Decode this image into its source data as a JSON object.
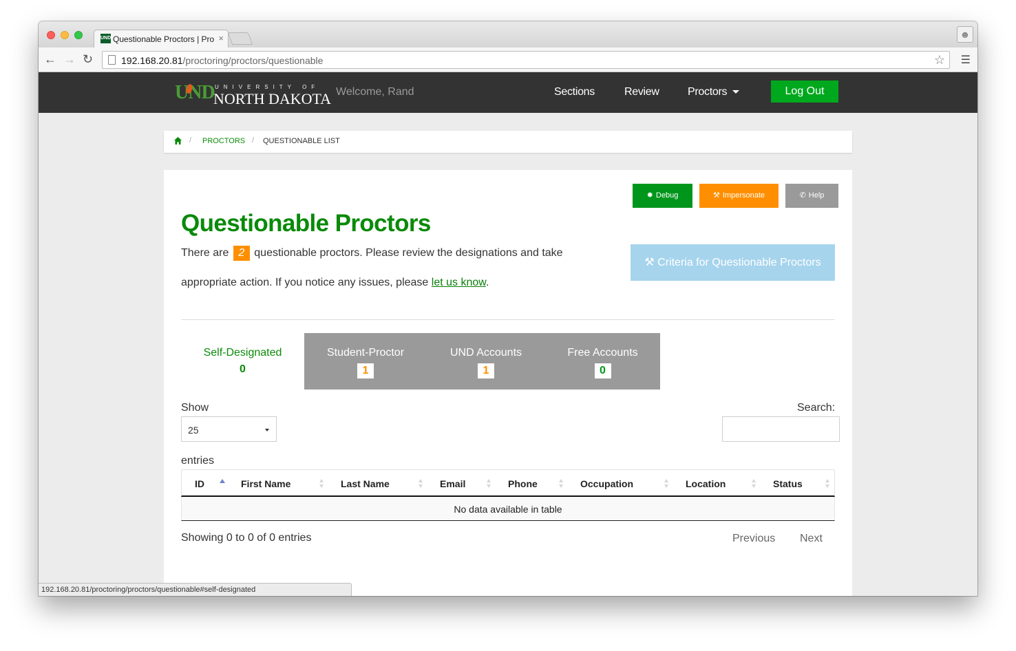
{
  "browser": {
    "tab_title": "Questionable Proctors | Pro",
    "tab_close": "×",
    "favicon_text": "UND",
    "url_host": "192.168.20.81",
    "url_path": "/proctoring/proctors/questionable",
    "status_url": "192.168.20.81/proctoring/proctors/questionable#self-designated"
  },
  "navbar": {
    "logo_und": "UND",
    "logo_university": "UNIVERSITY OF",
    "logo_north_dakota": "NORTH DAKOTA",
    "welcome": "Welcome, Rand",
    "links": {
      "sections": "Sections",
      "review": "Review",
      "proctors": "Proctors"
    },
    "logout": "Log Out"
  },
  "breadcrumb": {
    "sep": "/",
    "proctors": "PROCTORS",
    "current": "QUESTIONABLE LIST"
  },
  "actions": {
    "debug": "Debug",
    "impersonate": "Impersonate",
    "help": "Help",
    "criteria": "Criteria for Questionable Proctors"
  },
  "page": {
    "title": "Questionable Proctors",
    "desc_pre": "There are",
    "count": "2",
    "desc_post": "questionable proctors. Please review the designations and take",
    "desc_line2_pre": "appropriate action. If you notice any issues, please",
    "desc_link": "let us know",
    "desc_line2_post": "."
  },
  "tabs": {
    "self": {
      "label": "Self-Designated",
      "count": "0"
    },
    "student": {
      "label": "Student-Proctor",
      "count": "1"
    },
    "und": {
      "label": "UND Accounts",
      "count": "1"
    },
    "free": {
      "label": "Free Accounts",
      "count": "0"
    }
  },
  "table_controls": {
    "show_label": "Show",
    "page_size": "25",
    "entries_label": "entries",
    "search_label": "Search:"
  },
  "table": {
    "columns": [
      "ID",
      "First Name",
      "Last Name",
      "Email",
      "Phone",
      "Occupation",
      "Location",
      "Status"
    ],
    "empty_message": "No data available in table"
  },
  "footer": {
    "showing": "Showing 0 to 0 of 0 entries",
    "previous": "Previous",
    "next": "Next"
  },
  "colors": {
    "brand_green": "#0a8a0a",
    "button_green": "#00a81e",
    "orange": "#ff8f00",
    "gray": "#9a9a9a",
    "light_blue": "#a6d4ed",
    "navbar": "#333333"
  }
}
